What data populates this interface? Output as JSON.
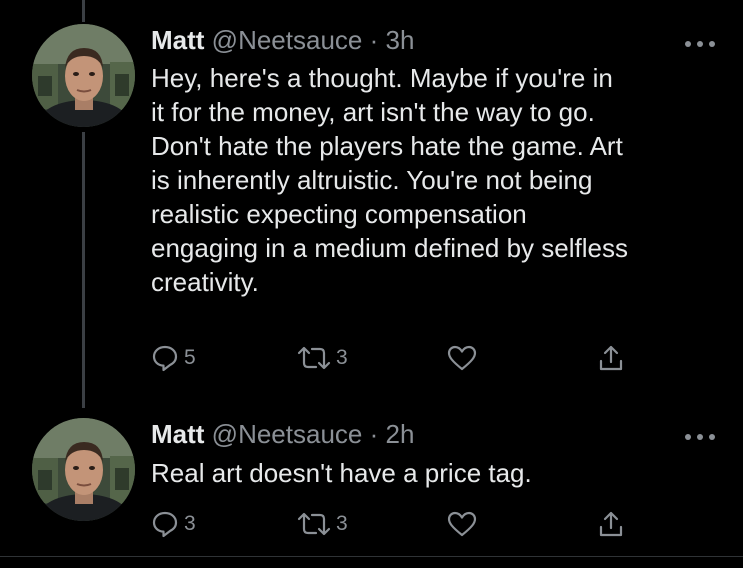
{
  "tweets": [
    {
      "author_name": "Matt",
      "handle": "@Neetsauce",
      "separator": "·",
      "time": "3h",
      "text_lines": [
        "Hey, here's a thought. Maybe if you're in",
        "it for the money, art isn't the way to go.",
        "Don't hate the players hate the game. Art",
        "is inherently altruistic. You're not being",
        "realistic expecting compensation",
        "engaging in a medium defined by selfless",
        "creativity."
      ],
      "reply_count": "5",
      "retweet_count": "3",
      "like_count": "",
      "icons": [
        "reply-icon",
        "retweet-icon",
        "like-icon",
        "share-icon",
        "more-icon"
      ]
    },
    {
      "author_name": "Matt",
      "handle": "@Neetsauce",
      "separator": "·",
      "time": "2h",
      "text_lines": [
        "Real art doesn't have a price tag."
      ],
      "reply_count": "3",
      "retweet_count": "3",
      "like_count": "",
      "icons": [
        "reply-icon",
        "retweet-icon",
        "like-icon",
        "share-icon",
        "more-icon"
      ]
    }
  ],
  "colors": {
    "background": "#000000",
    "primary_text": "#e7e9ea",
    "secondary_text": "#8b9096",
    "thread_line": "#3b3f44"
  }
}
